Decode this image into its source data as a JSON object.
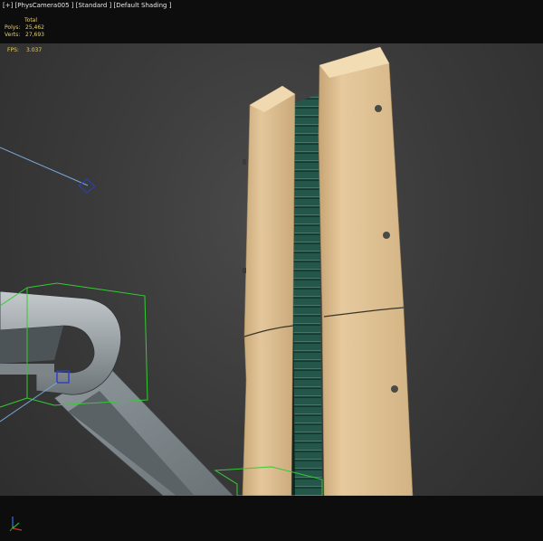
{
  "viewport": {
    "label": "[+] [PhysCamera005 ] [Standard ] [Default Shading ]",
    "stats": {
      "header": "Total",
      "polys_label": "Polys:",
      "polys_value": "25,462",
      "verts_label": "Verts:",
      "verts_value": "27,693"
    },
    "fps": {
      "label": "FPS:",
      "value": "3.037"
    }
  },
  "colors": {
    "background": "#3b3b3b",
    "letterbox": "#0d0d0d",
    "stats_text": "#e8d06a",
    "selection_box": "#33cc33",
    "pillar": "#d9bb8c",
    "slats": "#1f4a3f",
    "pipe": "#8a9296"
  },
  "icons": {
    "axis": "axis-tripod-icon"
  }
}
